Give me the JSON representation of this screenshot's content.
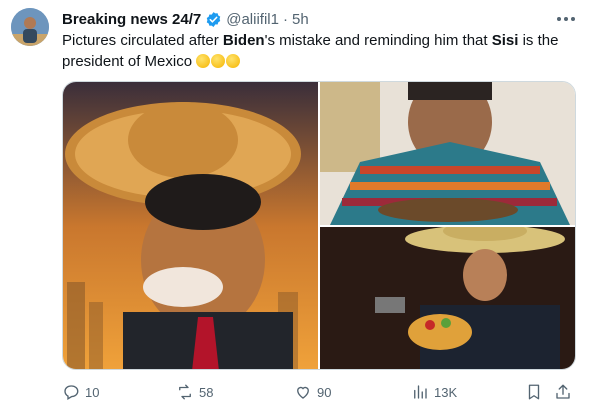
{
  "tweet": {
    "author_name": "Breaking news 24/7",
    "handle": "@aliifil1",
    "separator": "·",
    "time": "5h",
    "text": {
      "part1": "Pictures circulated after ",
      "bold1": "Biden",
      "part2": "'s mistake and reminding him that ",
      "bold2": "Sisi",
      "part3": " is the president of Mexico "
    },
    "emoji_count": 3
  },
  "stats": {
    "replies": "10",
    "reposts": "58",
    "likes": "90",
    "views": "13K"
  },
  "icons": {
    "verified": "verified-badge-icon",
    "more": "more-icon",
    "reply": "reply-icon",
    "repost": "repost-icon",
    "like": "like-icon",
    "views": "views-icon",
    "bookmark": "bookmark-icon",
    "share": "share-icon"
  },
  "colors": {
    "verified": "#1d9bf0",
    "text_secondary": "#536471",
    "text_primary": "#0f1419"
  }
}
